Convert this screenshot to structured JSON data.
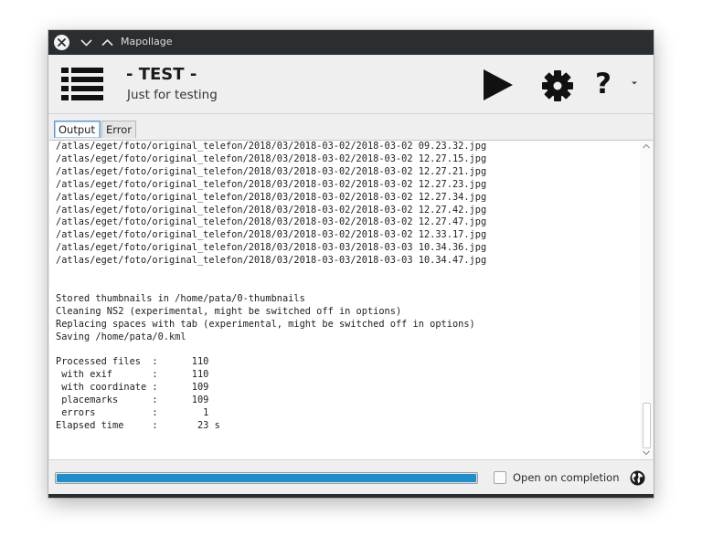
{
  "window": {
    "title": "Mapollage"
  },
  "header": {
    "title": "- TEST -",
    "subtitle": "Just for testing"
  },
  "toolbar": {
    "menu_icon": "list-icon",
    "run_icon": "play-icon",
    "settings_icon": "gear-icon",
    "help_label": "?",
    "help_dropdown_icon": "chevron-down-icon"
  },
  "tabs": [
    {
      "label": "Output",
      "active": true
    },
    {
      "label": "Error",
      "active": false
    }
  ],
  "log": {
    "lines": [
      "/atlas/eget/foto/original_telefon/2018/03/2018-03-02/2018-03-02 09.23.32.jpg",
      "/atlas/eget/foto/original_telefon/2018/03/2018-03-02/2018-03-02 12.27.15.jpg",
      "/atlas/eget/foto/original_telefon/2018/03/2018-03-02/2018-03-02 12.27.21.jpg",
      "/atlas/eget/foto/original_telefon/2018/03/2018-03-02/2018-03-02 12.27.23.jpg",
      "/atlas/eget/foto/original_telefon/2018/03/2018-03-02/2018-03-02 12.27.34.jpg",
      "/atlas/eget/foto/original_telefon/2018/03/2018-03-02/2018-03-02 12.27.42.jpg",
      "/atlas/eget/foto/original_telefon/2018/03/2018-03-02/2018-03-02 12.27.47.jpg",
      "/atlas/eget/foto/original_telefon/2018/03/2018-03-02/2018-03-02 12.33.17.jpg",
      "/atlas/eget/foto/original_telefon/2018/03/2018-03-03/2018-03-03 10.34.36.jpg",
      "/atlas/eget/foto/original_telefon/2018/03/2018-03-03/2018-03-03 10.34.47.jpg",
      "",
      "",
      "Stored thumbnails in /home/pata/0-thumbnails",
      "Cleaning NS2 (experimental, might be switched off in options)",
      "Replacing spaces with tab (experimental, might be switched off in options)",
      "Saving /home/pata/0.kml",
      "",
      "Processed files  :      110",
      " with exif       :      110",
      " with coordinate :      109",
      " placemarks      :      109",
      " errors          :        1",
      "Elapsed time     :       23 s"
    ]
  },
  "status": {
    "progress_fraction": 1.0,
    "open_on_completion_label": "Open on completion",
    "open_on_completion_checked": false,
    "globe_icon": "globe-icon"
  },
  "colors": {
    "titlebar": "#2b2e31",
    "progress": "#1c8fcc",
    "tab_focus": "#5a9bd6"
  }
}
